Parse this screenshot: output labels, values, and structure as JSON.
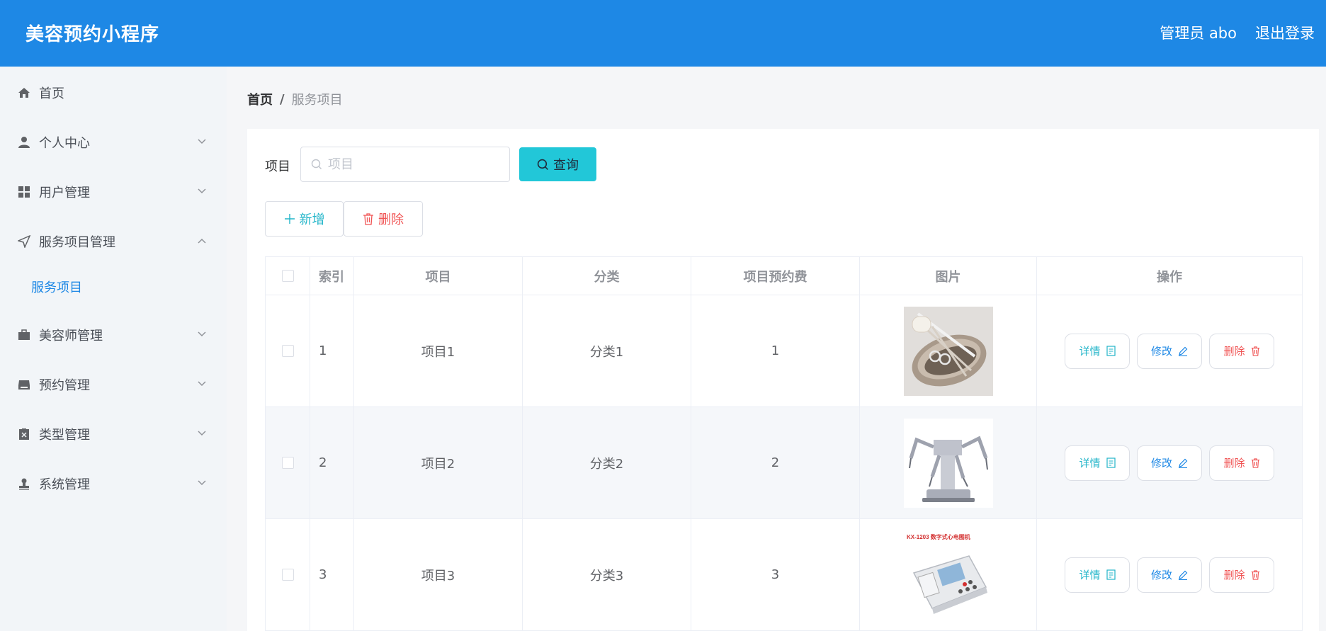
{
  "header": {
    "title": "美容预约小程序",
    "user": "管理员 abo",
    "logout": "退出登录"
  },
  "sidebar": {
    "items": [
      {
        "label": "首页",
        "icon": "home-icon"
      },
      {
        "label": "个人中心",
        "icon": "user-icon"
      },
      {
        "label": "用户管理",
        "icon": "grid-icon"
      },
      {
        "label": "服务项目管理",
        "icon": "send-icon",
        "expanded": true
      },
      {
        "label": "美容师管理",
        "icon": "briefcase-icon"
      },
      {
        "label": "预约管理",
        "icon": "inbox-icon"
      },
      {
        "label": "类型管理",
        "icon": "clipboard-icon"
      },
      {
        "label": "系统管理",
        "icon": "stamp-icon"
      }
    ],
    "subitem": {
      "label": "服务项目"
    }
  },
  "breadcrumb": {
    "home": "首页",
    "separator": "/",
    "current": "服务项目"
  },
  "search": {
    "label": "项目",
    "placeholder": "项目",
    "button": "查询"
  },
  "actions": {
    "add": "新增",
    "delete": "删除"
  },
  "table": {
    "headers": [
      "索引",
      "项目",
      "分类",
      "项目预约费",
      "图片",
      "操作"
    ],
    "rows": [
      {
        "index": "1",
        "item": "项目1",
        "category": "分类1",
        "fee": "1",
        "image": "surgical-tools-image"
      },
      {
        "index": "2",
        "item": "项目2",
        "category": "分类2",
        "fee": "2",
        "image": "robot-arm-image"
      },
      {
        "index": "3",
        "item": "项目3",
        "category": "分类3",
        "fee": "3",
        "image": "ecg-device-image",
        "image_caption": "KX-1203 数字式心电图机"
      }
    ],
    "ops": {
      "detail": "详情",
      "edit": "修改",
      "delete": "删除"
    }
  },
  "colors": {
    "primary": "#1e88e5",
    "accent": "#22c7d8",
    "danger": "#f05454"
  }
}
